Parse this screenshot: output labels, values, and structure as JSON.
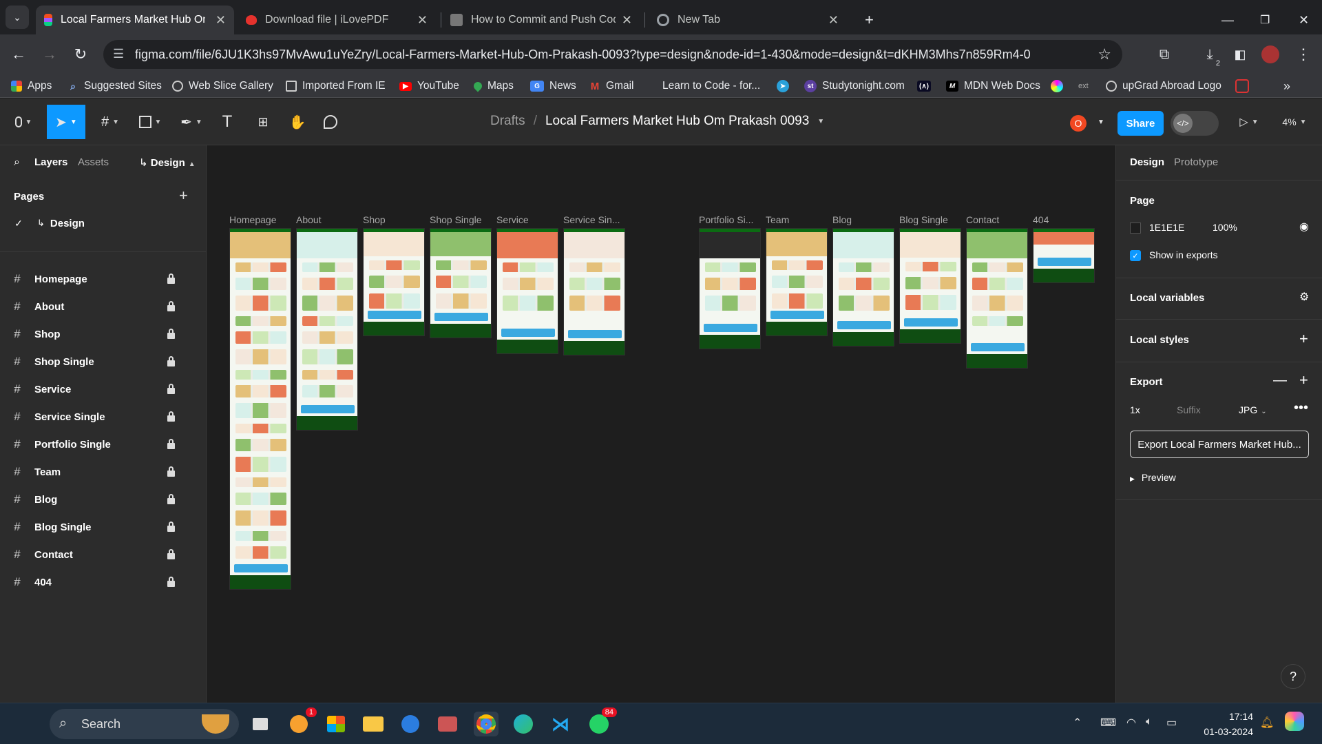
{
  "browser": {
    "tabs": [
      {
        "title": "Local Farmers Market Hub Om Prakash",
        "active": true,
        "fav_color": "#f24e1e"
      },
      {
        "title": "Download file | iLovePDF",
        "active": false,
        "fav_color": "#e5322d"
      },
      {
        "title": "How to Commit and Push Code",
        "active": false,
        "fav_color": "#888888"
      },
      {
        "title": "New Tab",
        "active": false,
        "fav_color": "#9aa0a6"
      }
    ],
    "url": "figma.com/file/6JU1K3hs97MvAwu1uYeZry/Local-Farmers-Market-Hub-Om-Prakash-0093?type=design&node-id=1-430&mode=design&t=dKHM3Mhs7n859Rm4-0",
    "bookmarks": [
      "Apps",
      "Suggested Sites",
      "Web Slice Gallery",
      "Imported From IE",
      "YouTube",
      "Maps",
      "News",
      "Gmail",
      "Learn to Code - for...",
      "",
      "Studytonight.com",
      "",
      "MDN Web Docs",
      "",
      "ext",
      "upGrad Abroad Logo",
      ""
    ],
    "download_count": "2"
  },
  "figma": {
    "breadcrumb_drafts": "Drafts",
    "file_title": "Local Farmers Market Hub Om Prakash 0093",
    "avatar_letter": "O",
    "share_label": "Share",
    "zoom": "4%",
    "left_tabs": {
      "layers": "Layers",
      "assets": "Assets",
      "design": "Design"
    },
    "pages_heading": "Pages",
    "current_page": "Design",
    "layers": [
      "Homepage",
      "About",
      "Shop",
      "Shop Single",
      "Service",
      "Service Single",
      "Portfolio Single",
      "Team",
      "Blog",
      "Blog Single",
      "Contact",
      "404"
    ],
    "frames": [
      "Homepage",
      "About",
      "Shop",
      "Shop Single",
      "Service",
      "Service Sin...",
      "Portfolio Si...",
      "Team",
      "Blog",
      "Blog Single",
      "Contact",
      "404"
    ],
    "right": {
      "tab_design": "Design",
      "tab_prototype": "Prototype",
      "page_heading": "Page",
      "page_color": "1E1E1E",
      "page_opacity": "100%",
      "show_in_exports": "Show in exports",
      "local_variables": "Local variables",
      "local_styles": "Local styles",
      "export_heading": "Export",
      "export_scale": "1x",
      "export_suffix_placeholder": "Suffix",
      "export_format": "JPG",
      "export_button": "Export Local Farmers Market Hub...",
      "preview": "Preview"
    },
    "colors": {
      "accent": "#0d99ff",
      "brand_green": "#0b6b12",
      "footer_green": "#0f4d12",
      "cta_blue": "#3aa9e0"
    }
  },
  "taskbar": {
    "search_label": "Search",
    "time": "17:14",
    "date": "01-03-2024",
    "badges": {
      "notif_app": "1",
      "whatsapp": "84"
    }
  }
}
